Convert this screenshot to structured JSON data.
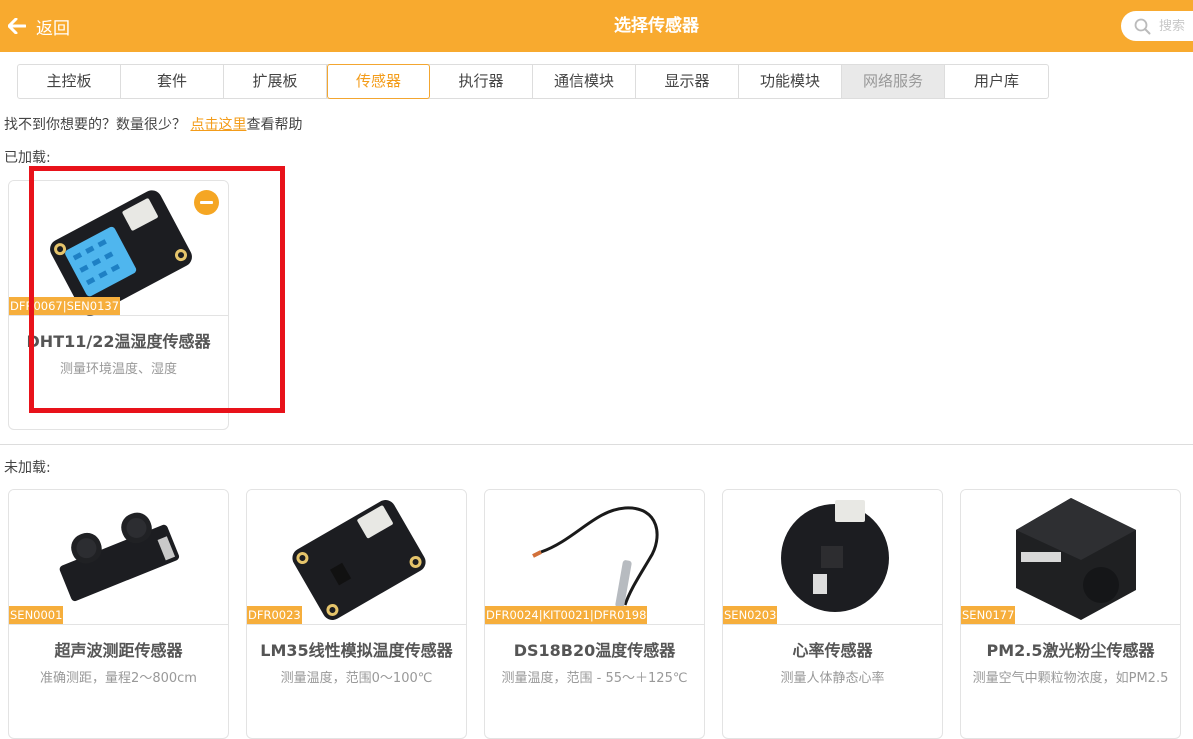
{
  "header": {
    "back_label": "返回",
    "title": "选择传感器",
    "search_placeholder": "搜索"
  },
  "tabs": [
    {
      "label": "主控板",
      "state": "normal"
    },
    {
      "label": "套件",
      "state": "normal"
    },
    {
      "label": "扩展板",
      "state": "normal"
    },
    {
      "label": "传感器",
      "state": "active"
    },
    {
      "label": "执行器",
      "state": "normal"
    },
    {
      "label": "通信模块",
      "state": "normal"
    },
    {
      "label": "显示器",
      "state": "normal"
    },
    {
      "label": "功能模块",
      "state": "normal"
    },
    {
      "label": "网络服务",
      "state": "disabled"
    },
    {
      "label": "用户库",
      "state": "normal"
    }
  ],
  "help": {
    "prefix": "找不到你想要的？数量很少？",
    "link": "点击这里",
    "suffix": "查看帮助"
  },
  "loaded": {
    "label": "已加载:",
    "items": [
      {
        "code": "DFR0067|SEN0137",
        "name": "DHT11/22温湿度传感器",
        "desc": "测量环境温度、湿度",
        "image": "dht11-module"
      }
    ]
  },
  "unloaded": {
    "label": "未加载:",
    "items": [
      {
        "code": "SEN0001",
        "name": "超声波测距传感器",
        "desc": "准确测距，量程2～800cm",
        "image": "ultrasonic-module"
      },
      {
        "code": "DFR0023",
        "name": "LM35线性模拟温度传感器",
        "desc": "测量温度，范围0～100℃",
        "image": "lm35-module"
      },
      {
        "code": "DFR0024|KIT0021|DFR0198",
        "name": "DS18B20温度传感器",
        "desc": "测量温度，范围 - 55～＋125℃",
        "image": "ds18b20-probe"
      },
      {
        "code": "SEN0203",
        "name": "心率传感器",
        "desc": "测量人体静态心率",
        "image": "heart-rate-module"
      },
      {
        "code": "SEN0177",
        "name": "PM2.5激光粉尘传感器",
        "desc": "测量空气中颗粒物浓度，如PM2.5",
        "image": "pm25-sensor"
      }
    ]
  },
  "colors": {
    "accent": "#f8aa2f",
    "highlight": "#e8121a"
  }
}
